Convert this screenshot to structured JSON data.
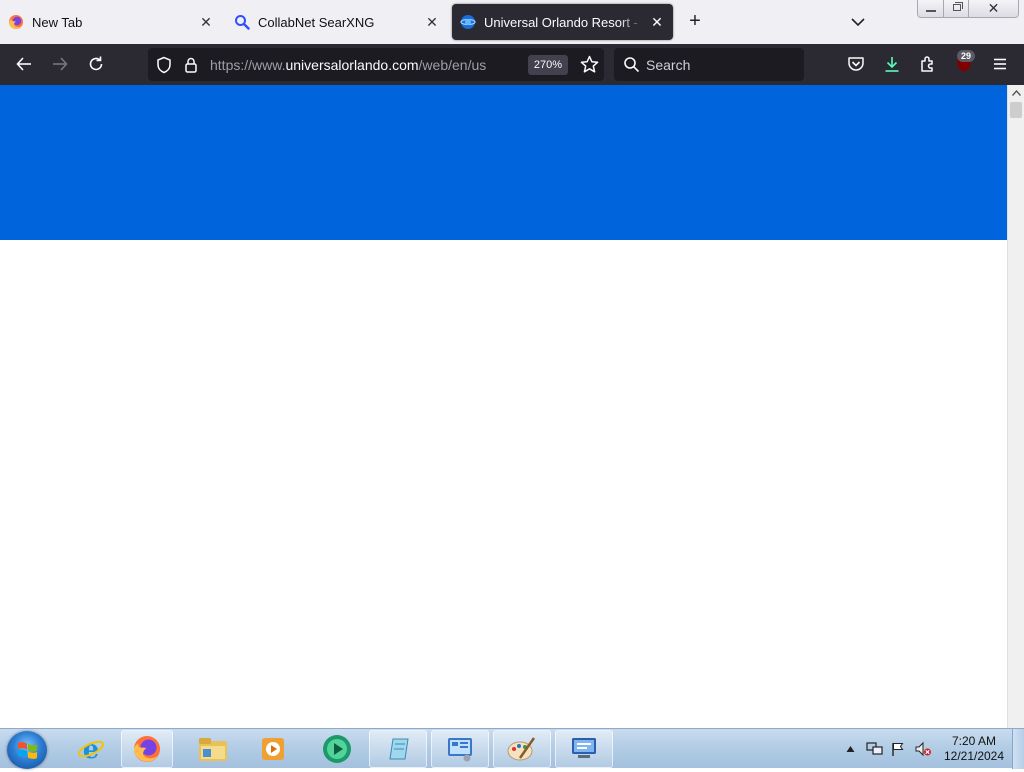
{
  "browser": {
    "tabs": [
      {
        "title": "New Tab",
        "active": false,
        "icon": "firefox-icon"
      },
      {
        "title": "CollabNet SearXNG",
        "active": false,
        "icon": "search-icon"
      },
      {
        "title": "Universal Orlando Resort - Your",
        "active": true,
        "icon": "universal-globe-icon"
      }
    ],
    "url": {
      "prefix": "https://www.",
      "domain": "universalorlando.com",
      "path": "/web/en/us"
    },
    "zoom": "270%",
    "search_placeholder": "Search",
    "extensions_badge": "29"
  },
  "page": {
    "hero_color": "#0065dd"
  },
  "taskbar": {
    "clock_time": "7:20 AM",
    "clock_date": "12/21/2024",
    "items": [
      "internet-explorer-icon",
      "firefox-icon",
      "file-explorer-icon",
      "media-player-icon",
      "media-center-icon",
      "notepad-icon",
      "control-panel-icon",
      "paint-icon",
      "remote-desktop-icon"
    ]
  }
}
